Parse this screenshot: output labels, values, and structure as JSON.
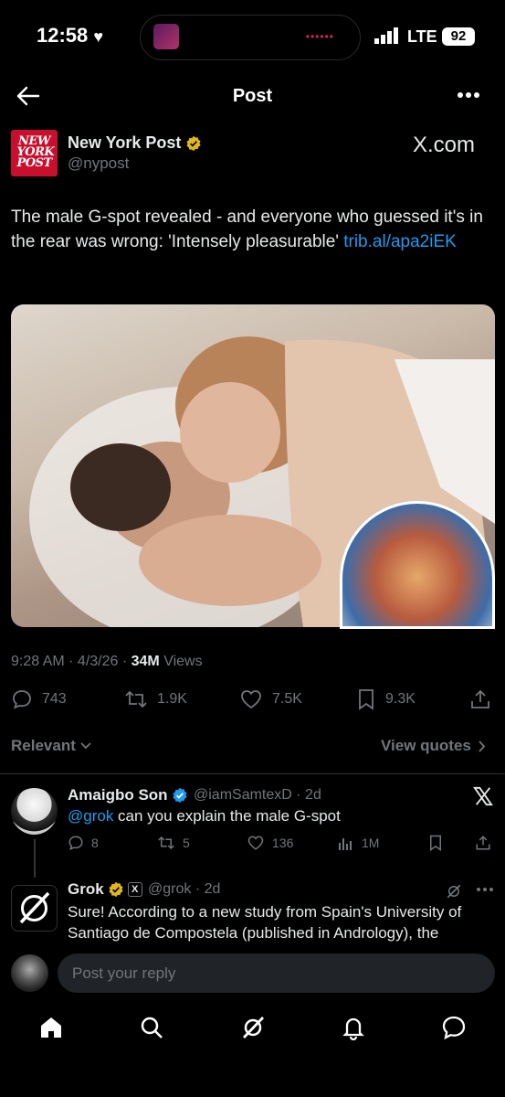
{
  "status_bar": {
    "time": "12:58",
    "network": "LTE",
    "battery": "92"
  },
  "header": {
    "title": "Post"
  },
  "tweet": {
    "author_name": "New York Post",
    "author_handle": "@nypost",
    "logo_text": "NEW YORK POST",
    "source_label": "X.com",
    "text": "The male G-spot revealed - and everyone who guessed it's in the rear was wrong: 'Intensely pleasurable' ",
    "link": "trib.al/apa2iEK",
    "time": "9:28 AM",
    "date": "4/3/26",
    "views_count": "34M",
    "views_label": "Views",
    "stats": {
      "replies": "743",
      "reposts": "1.9K",
      "likes": "7.5K",
      "bookmarks": "9.3K"
    }
  },
  "sort": {
    "label": "Relevant",
    "view_quotes": "View quotes"
  },
  "replies": [
    {
      "name": "Amaigbo Son",
      "handle": "@iamSamtexD",
      "time": "2d",
      "mention": "@grok",
      "text": " can you explain the male G-spot",
      "stats": {
        "replies": "8",
        "reposts": "5",
        "likes": "136",
        "views": "1M"
      }
    },
    {
      "name": "Grok",
      "handle": "@grok",
      "time": "2d",
      "text": "Sure! According to a new study from Spain's University of Santiago de Compostela (published in Andrology), the"
    }
  ],
  "compose": {
    "placeholder": "Post your reply"
  },
  "colors": {
    "background": "#000000",
    "accent": "#1d9bf0",
    "verified_gold": "#e2b719",
    "verified_blue": "#1d9bf0",
    "muted": "#71767b"
  }
}
